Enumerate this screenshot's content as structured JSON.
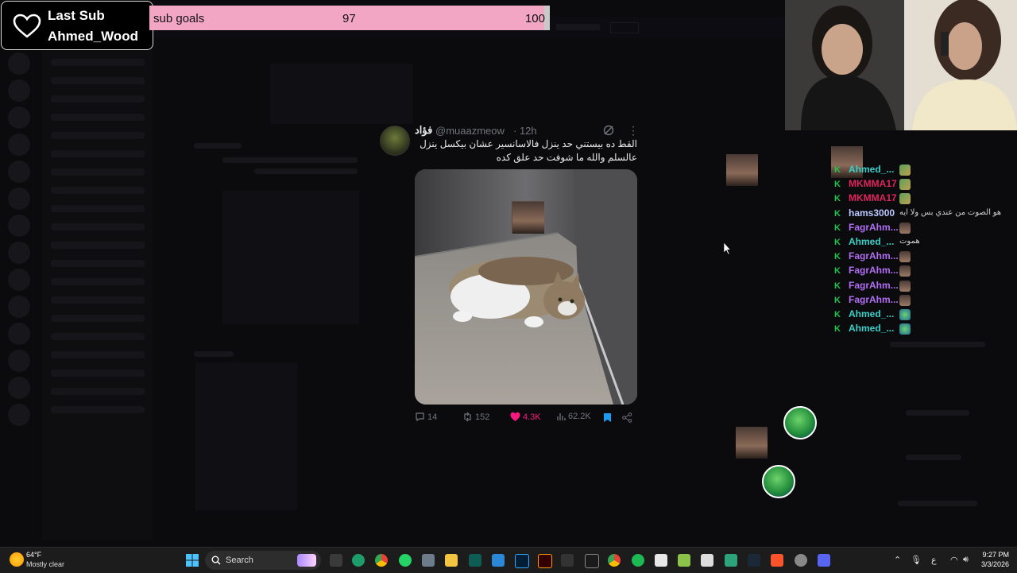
{
  "overlay": {
    "last_sub_label": "Last Sub",
    "last_sub_name": "Ahmed_Wood",
    "goal_label": "sub goals",
    "goal_current": "97",
    "goal_target": "100",
    "goal_progress": 0.97,
    "goal_color": "#f3a6c4"
  },
  "tweet": {
    "name": "فؤاد",
    "handle": "@muaazmeow",
    "time": "· 12h",
    "text_line1": "القط ده بيستني حد ينزل فالاسانسير عشان بيكسل ينزل",
    "text_line2": "عالسلم والله ما شوفت حد علق كده",
    "replies": "14",
    "retweets": "152",
    "likes": "4.3K",
    "views": "62.2K",
    "like_color": "#f91880",
    "bookmark_color": "#1d9bf0"
  },
  "chat": {
    "messages": [
      {
        "user": "Ahmed_...",
        "color": "#3ad1c9",
        "badge": "K",
        "emote": true
      },
      {
        "user": "MKMMA17",
        "color": "#e0245e",
        "badge": "K",
        "emote": true
      },
      {
        "user": "MKMMA17",
        "color": "#e0245e",
        "badge": "K",
        "emote": true
      },
      {
        "user": "hams3000",
        "color": "#b9c8ff",
        "badge": "K",
        "text": "هو الصوت من عندي بس ولا ايه"
      },
      {
        "user": "FagrAhm...",
        "color": "#b16ef5",
        "badge": "K",
        "emote": true
      },
      {
        "user": "Ahmed_...",
        "color": "#3ad1c9",
        "badge": "K",
        "text": "هموت"
      },
      {
        "user": "FagrAhm...",
        "color": "#b16ef5",
        "badge": "K",
        "emote": true
      },
      {
        "user": "FagrAhm...",
        "color": "#b16ef5",
        "badge": "K",
        "emote": true
      },
      {
        "user": "FagrAhm...",
        "color": "#b16ef5",
        "badge": "K",
        "emote": true
      },
      {
        "user": "FagrAhm...",
        "color": "#b16ef5",
        "badge": "K",
        "emote": true
      },
      {
        "user": "Ahmed_...",
        "color": "#3ad1c9",
        "badge": "K",
        "emote": true
      },
      {
        "user": "Ahmed_...",
        "color": "#3ad1c9",
        "badge": "K",
        "emote": true
      }
    ]
  },
  "taskbar": {
    "temperature": "64°F",
    "condition": "Mostly clear",
    "search_label": "Search",
    "time": "9:27 PM",
    "date": "3/3/2026",
    "lang": "ع"
  }
}
